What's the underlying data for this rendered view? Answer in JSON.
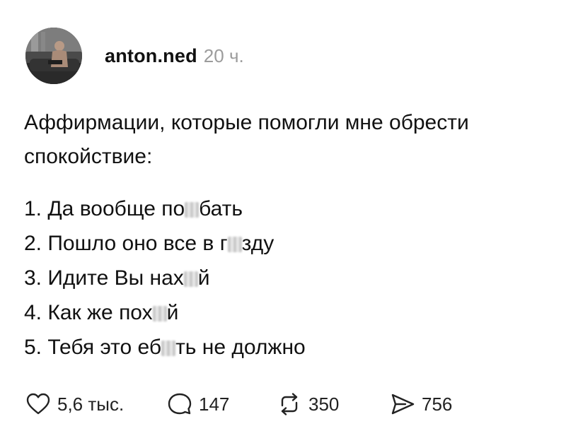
{
  "post": {
    "author": "anton.ned",
    "time": "20 ч.",
    "intro": "Аффирмации, которые помогли мне обрести спокойствие:",
    "items": [
      {
        "before": "1. Да вообще по",
        "after": "бать"
      },
      {
        "before": "2. Пошло оно все в г",
        "after": "зду"
      },
      {
        "before": "3. Идите Вы нах",
        "after": "й"
      },
      {
        "before": "4. Как же пох",
        "after": "й"
      },
      {
        "before": "5. Тебя это еб",
        "after": "ть не должно"
      }
    ]
  },
  "actions": {
    "likes": "5,6 тыс.",
    "comments": "147",
    "reposts": "350",
    "shares": "756"
  },
  "icons": {
    "avatar": "profile-photo",
    "like": "heart-icon",
    "comment": "speech-bubble-icon",
    "repost": "repost-arrows-icon",
    "share": "send-arrow-icon"
  }
}
